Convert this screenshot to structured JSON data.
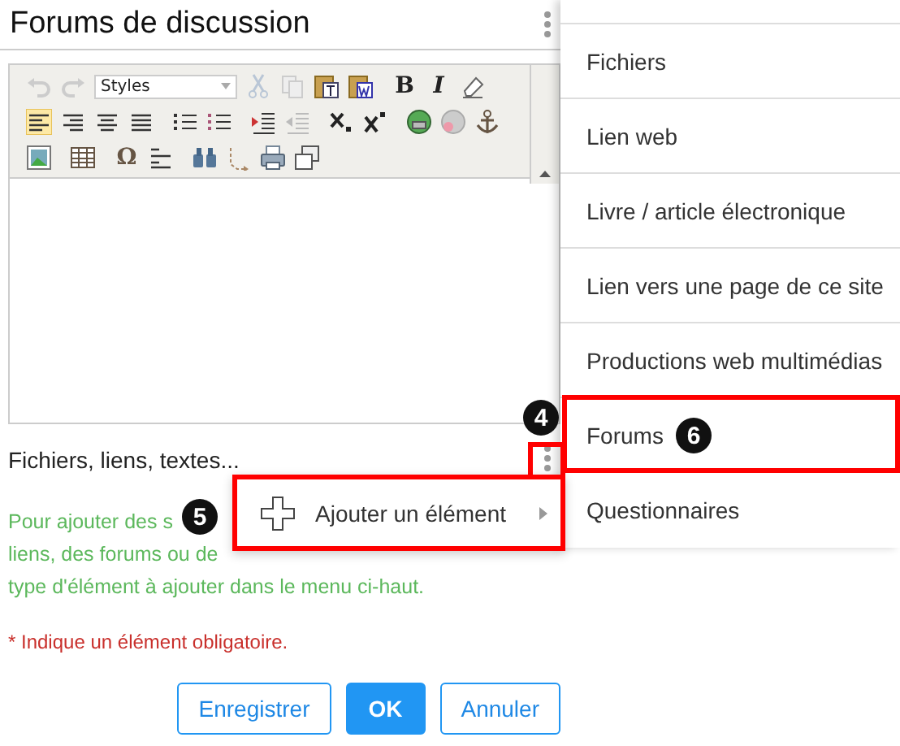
{
  "title": "Forums de discussion",
  "editor": {
    "styles_placeholder": "Styles",
    "bold": "B",
    "italic": "I",
    "omega": "Ω",
    "align_buttons": [
      {
        "selected": true
      },
      {
        "selected": false
      },
      {
        "selected": false
      },
      {
        "selected": false
      }
    ]
  },
  "section_label": "Fichiers, liens, textes...",
  "help_lines": [
    "Pour ajouter des s",
    "liens, des forums ou de",
    "type d'élément à ajouter dans le menu ci-haut."
  ],
  "required_note": {
    "mark": "*",
    "text": "Indique un élément obligatoire."
  },
  "buttons": [
    {
      "label": "Enregistrer",
      "kind": "outline"
    },
    {
      "label": "OK",
      "kind": "primary"
    },
    {
      "label": "Annuler",
      "kind": "outline"
    }
  ],
  "submenu": {
    "label": "Ajouter un élément"
  },
  "type_menu": [
    "Fichiers",
    "Lien web",
    "Livre / article électronique",
    "Lien vers une page de ce site",
    "Productions web multimédias",
    "Forums",
    "Questionnaires"
  ],
  "callouts": [
    "4",
    "5",
    "6"
  ]
}
